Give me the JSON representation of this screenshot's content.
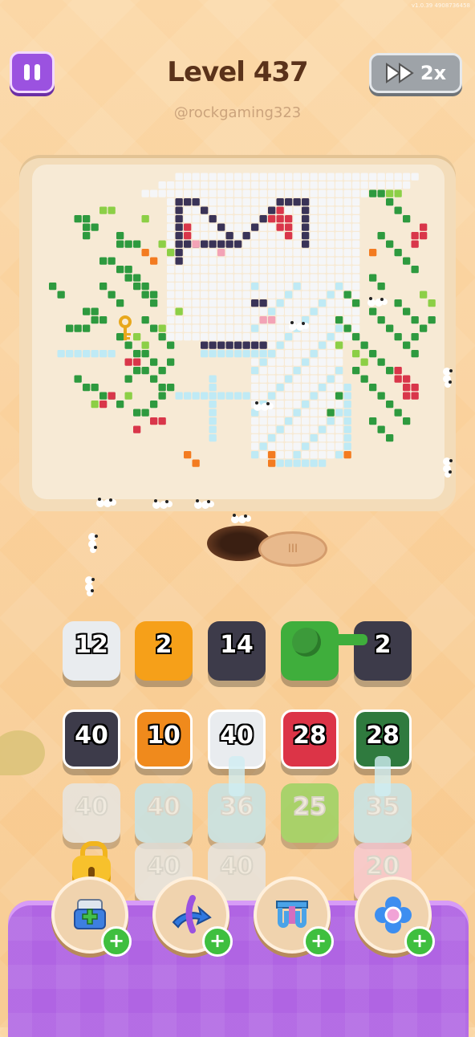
{
  "header": {
    "version": "v1.0.39    4908736458",
    "title": "Level 437",
    "username": "@rockgaming323",
    "speed_label": "2x"
  },
  "icons": [
    "pause-icon",
    "fast-forward-icon",
    "key-icon",
    "lock-icon",
    "add-tiles-icon",
    "swap-arrows-icon",
    "magnet-icon",
    "flower-icon",
    "plus-icon"
  ],
  "hole_label": "III",
  "grid": {
    "row1": [
      {
        "value": "12",
        "color": "#e9ecef"
      },
      {
        "value": "2",
        "color": "#f6a019"
      },
      {
        "value": "14",
        "color": "#3d3b4a"
      },
      {
        "value": "",
        "color": "#3fae3c"
      },
      {
        "value": "2",
        "color": "#3d3b4a"
      }
    ],
    "row2": [
      {
        "value": "40",
        "color": "#3d3b4a"
      },
      {
        "value": "10",
        "color": "#f08a1c"
      },
      {
        "value": "40",
        "color": "#e9ecef"
      },
      {
        "value": "28",
        "color": "#dc3447"
      },
      {
        "value": "28",
        "color": "#2f7a3e"
      }
    ],
    "row3": [
      {
        "value": "40",
        "color": "#e4e8ea"
      },
      {
        "value": "40",
        "color": "#bfe6f1"
      },
      {
        "value": "36",
        "color": "#bfe6f1"
      },
      {
        "value": "25",
        "color": "#8fd35c"
      },
      {
        "value": "35",
        "color": "#bfe6f1"
      }
    ],
    "row4": [
      {
        "value": "40",
        "color": "#e4e8ea"
      },
      {
        "value": "40",
        "color": "#e4e8ea"
      },
      {
        "value": "20",
        "color": "#f7c9d9"
      }
    ]
  },
  "colors": {
    "pixel_white": "#f5f6f8",
    "pixel_cyan": "#bfeaf5",
    "pixel_green": "#2e9a3f",
    "pixel_lightgreen": "#8ccf46",
    "pixel_red": "#d9364a",
    "pixel_navy": "#3a3357",
    "pixel_orange": "#f37b20",
    "pixel_pink": "#f3a3b6",
    "tray": "#b064e3"
  }
}
